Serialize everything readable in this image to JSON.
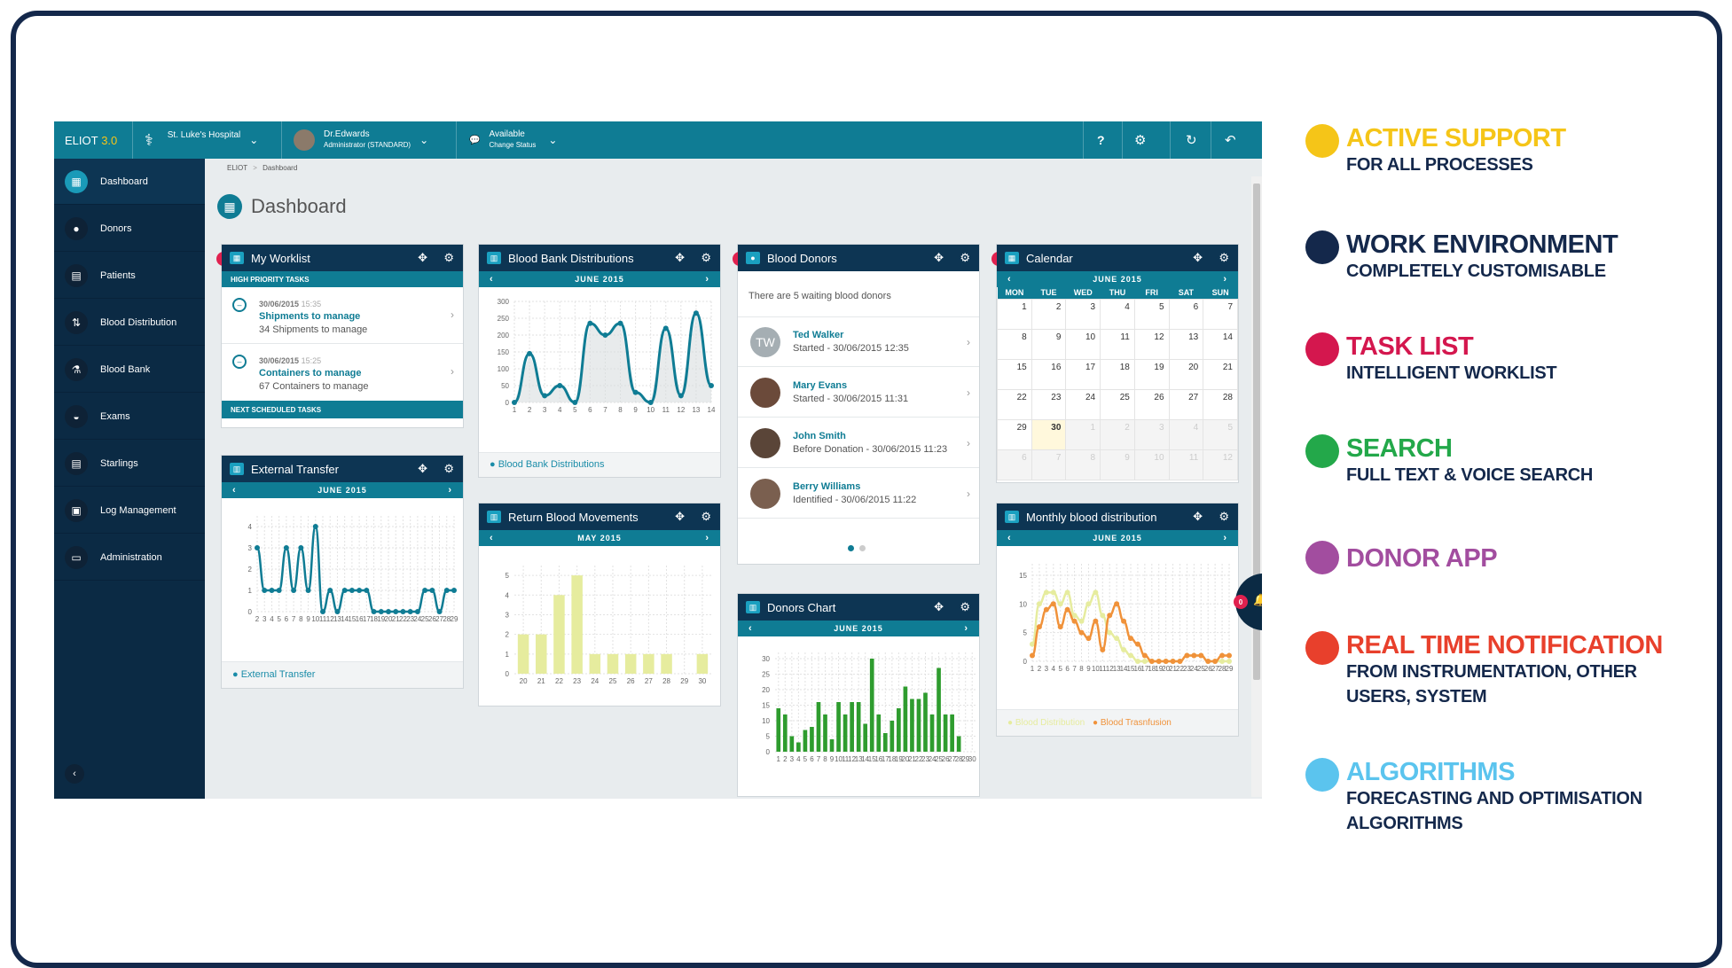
{
  "app": {
    "name": "ELIOT",
    "version": "3.0",
    "hospital": "St. Luke's Hospital",
    "user_name": "Dr.Edwards",
    "user_role": "Administrator (STANDARD)",
    "status": "Available",
    "status_sub": "Change Status"
  },
  "topbar_icons": [
    "help-icon",
    "settings-icon",
    "refresh-icon",
    "logout-icon"
  ],
  "sidebar": {
    "items": [
      {
        "label": "Dashboard",
        "icon": "grid-icon"
      },
      {
        "label": "Donors",
        "icon": "drop-icon"
      },
      {
        "label": "Patients",
        "icon": "patient-icon"
      },
      {
        "label": "Blood Distribution",
        "icon": "distribution-icon"
      },
      {
        "label": "Blood Bank",
        "icon": "flask-icon"
      },
      {
        "label": "Exams",
        "icon": "exam-icon"
      },
      {
        "label": "Starlings",
        "icon": "starlings-icon"
      },
      {
        "label": "Log Management",
        "icon": "log-icon"
      },
      {
        "label": "Administration",
        "icon": "monitor-icon"
      }
    ]
  },
  "breadcrumb": {
    "root": "ELIOT",
    "sep": ">",
    "current": "Dashboard"
  },
  "page_title": "Dashboard",
  "worklist": {
    "title": "My Worklist",
    "badge": "0",
    "high_priority": "HIGH PRIORITY TASKS",
    "tasks": [
      {
        "date": "30/06/2015",
        "time": "15:35",
        "title": "Shipments to manage",
        "desc": "34 Shipments to manage"
      },
      {
        "date": "30/06/2015",
        "time": "15:25",
        "title": "Containers to manage",
        "desc": "67 Containers to manage"
      }
    ],
    "next": "NEXT SCHEDULED TASKS"
  },
  "distributions": {
    "title": "Blood Bank Distributions",
    "month": "JUNE 2015",
    "legend": "Blood Bank Distributions"
  },
  "donors": {
    "title": "Blood Donors",
    "badge": "0",
    "waiting": "There are 5 waiting blood donors",
    "list": [
      {
        "name": "Ted Walker",
        "sub": "Started - 30/06/2015 12:35",
        "initials": "TW"
      },
      {
        "name": "Mary Evans",
        "sub": "Started - 30/06/2015 11:31",
        "initials": ""
      },
      {
        "name": "John Smith",
        "sub": "Before Donation - 30/06/2015 11:23",
        "initials": ""
      },
      {
        "name": "Berry Williams",
        "sub": "Identified - 30/06/2015 11:22",
        "initials": ""
      }
    ]
  },
  "calendar": {
    "title": "Calendar",
    "badge": "0",
    "month": "JUNE 2015",
    "days": [
      "MON",
      "TUE",
      "WED",
      "THU",
      "FRI",
      "SAT",
      "SUN"
    ],
    "weeks": [
      [
        "1",
        "2",
        "3",
        "4",
        "5",
        "6",
        "7"
      ],
      [
        "8",
        "9",
        "10",
        "11",
        "12",
        "13",
        "14"
      ],
      [
        "15",
        "16",
        "17",
        "18",
        "19",
        "20",
        "21"
      ],
      [
        "22",
        "23",
        "24",
        "25",
        "26",
        "27",
        "28"
      ],
      [
        "29",
        "30",
        "1",
        "2",
        "3",
        "4",
        "5"
      ],
      [
        "6",
        "7",
        "8",
        "9",
        "10",
        "11",
        "12"
      ]
    ],
    "today": "30"
  },
  "transfer": {
    "title": "External Transfer",
    "month": "JUNE 2015",
    "legend": "External Transfer"
  },
  "returns": {
    "title": "Return Blood Movements",
    "month": "MAY 2015"
  },
  "donors_chart": {
    "title": "Donors Chart",
    "month": "JUNE 2015"
  },
  "monthly": {
    "title": "Monthly blood distribution",
    "month": "JUNE 2015",
    "legend_a": "Blood Distribution",
    "legend_b": "Blood Trasnfusion"
  },
  "notif_badge": "0",
  "features": [
    {
      "title": "ACTIVE SUPPORT",
      "sub": [
        "FOR ALL PROCESSES"
      ],
      "color": "#f5c518"
    },
    {
      "title": "WORK ENVIRONMENT",
      "sub": [
        "COMPLETELY CUSTOMISABLE"
      ],
      "color": "#14284b"
    },
    {
      "title": "TASK LIST",
      "sub": [
        "INTELLIGENT WORKLIST"
      ],
      "color": "#d4174e"
    },
    {
      "title": "SEARCH",
      "sub": [
        "FULL TEXT & VOICE SEARCH"
      ],
      "color": "#23a84a"
    },
    {
      "title": "DONOR APP",
      "sub": [],
      "color": "#a24d9f"
    },
    {
      "title": "REAL TIME NOTIFICATION",
      "sub": [
        "FROM INSTRUMENTATION, OTHER",
        "USERS, SYSTEM"
      ],
      "color": "#e8402c"
    },
    {
      "title": "ALGORITHMS",
      "sub": [
        "FORECASTING AND OPTIMISATION",
        "ALGORITHMS"
      ],
      "color": "#5bc4ee"
    }
  ],
  "chart_data": [
    {
      "type": "line",
      "title": "Blood Bank Distributions",
      "categories": [
        "1",
        "2",
        "3",
        "4",
        "5",
        "6",
        "7",
        "8",
        "9",
        "10",
        "11",
        "12",
        "13",
        "14"
      ],
      "series": [
        {
          "name": "Blood Bank Distributions",
          "values": [
            0,
            145,
            20,
            50,
            0,
            235,
            200,
            235,
            30,
            0,
            220,
            20,
            265,
            50
          ]
        }
      ],
      "yticks": [
        0,
        50,
        100,
        150,
        200,
        250,
        300
      ],
      "ylim": [
        0,
        300
      ],
      "color": "#0f7c94"
    },
    {
      "type": "line",
      "title": "External Transfer",
      "categories": [
        "2",
        "3",
        "4",
        "5",
        "6",
        "7",
        "8",
        "9",
        "10",
        "11",
        "12",
        "13",
        "14",
        "15",
        "16",
        "17",
        "18",
        "19",
        "20",
        "21",
        "22",
        "23",
        "24",
        "25",
        "26",
        "27",
        "28",
        "29"
      ],
      "series": [
        {
          "name": "External Transfer",
          "values": [
            3,
            1,
            1,
            1,
            3,
            1,
            3,
            1,
            4,
            0,
            1,
            0,
            1,
            1,
            1,
            1,
            0,
            0,
            0,
            0,
            0,
            0,
            0,
            1,
            1,
            0,
            1,
            1
          ]
        }
      ],
      "yticks": [
        0,
        1,
        2,
        3,
        4
      ],
      "ylim": [
        0,
        4.5
      ],
      "color": "#0f7c94"
    },
    {
      "type": "bar",
      "title": "Return Blood Movements",
      "categories": [
        "20",
        "21",
        "22",
        "23",
        "24",
        "25",
        "26",
        "27",
        "28",
        "29",
        "30"
      ],
      "values": [
        2,
        2,
        4,
        5,
        1,
        1,
        1,
        1,
        1,
        0,
        1
      ],
      "yticks": [
        0,
        1,
        2,
        3,
        4,
        5
      ],
      "ylim": [
        0,
        5.5
      ],
      "color": "#e6ec9e"
    },
    {
      "type": "bar",
      "title": "Donors Chart",
      "categories": [
        "1",
        "2",
        "3",
        "4",
        "5",
        "6",
        "7",
        "8",
        "9",
        "10",
        "11",
        "12",
        "13",
        "14",
        "15",
        "16",
        "17",
        "18",
        "19",
        "20",
        "21",
        "22",
        "23",
        "24",
        "25",
        "26",
        "27",
        "28",
        "29",
        "30"
      ],
      "values": [
        14,
        12,
        5,
        3,
        7,
        8,
        16,
        12,
        4,
        16,
        12,
        16,
        16,
        9,
        30,
        12,
        6,
        10,
        14,
        21,
        17,
        17,
        19,
        12,
        27,
        12,
        12,
        5
      ],
      "yticks": [
        0,
        5,
        10,
        15,
        20,
        25,
        30
      ],
      "ylim": [
        0,
        32
      ],
      "color": "#2e9c2e"
    },
    {
      "type": "line",
      "title": "Monthly blood distribution",
      "categories": [
        "1",
        "2",
        "3",
        "4",
        "5",
        "6",
        "7",
        "8",
        "9",
        "10",
        "11",
        "12",
        "13",
        "14",
        "15",
        "16",
        "17",
        "18",
        "19",
        "20",
        "21",
        "22",
        "23",
        "24",
        "25",
        "26",
        "27",
        "28",
        "29"
      ],
      "series": [
        {
          "name": "Blood Distribution",
          "values": [
            3,
            10,
            12,
            12,
            10,
            12,
            8,
            7,
            10,
            12,
            8,
            5,
            4,
            2,
            1,
            0,
            0,
            0,
            0,
            0,
            0,
            0,
            1,
            1,
            1,
            0,
            0,
            0,
            0
          ],
          "color": "#e6ec9e"
        },
        {
          "name": "Blood Trasnfusion",
          "values": [
            1,
            6,
            9,
            10,
            6,
            9,
            7,
            5,
            4,
            7,
            2,
            8,
            10,
            7,
            4,
            3,
            1,
            0,
            0,
            0,
            0,
            0,
            1,
            1,
            1,
            0,
            0,
            1,
            1
          ],
          "color": "#f0923a"
        }
      ],
      "yticks": [
        0,
        5,
        10,
        15
      ],
      "ylim": [
        0,
        17
      ]
    }
  ]
}
